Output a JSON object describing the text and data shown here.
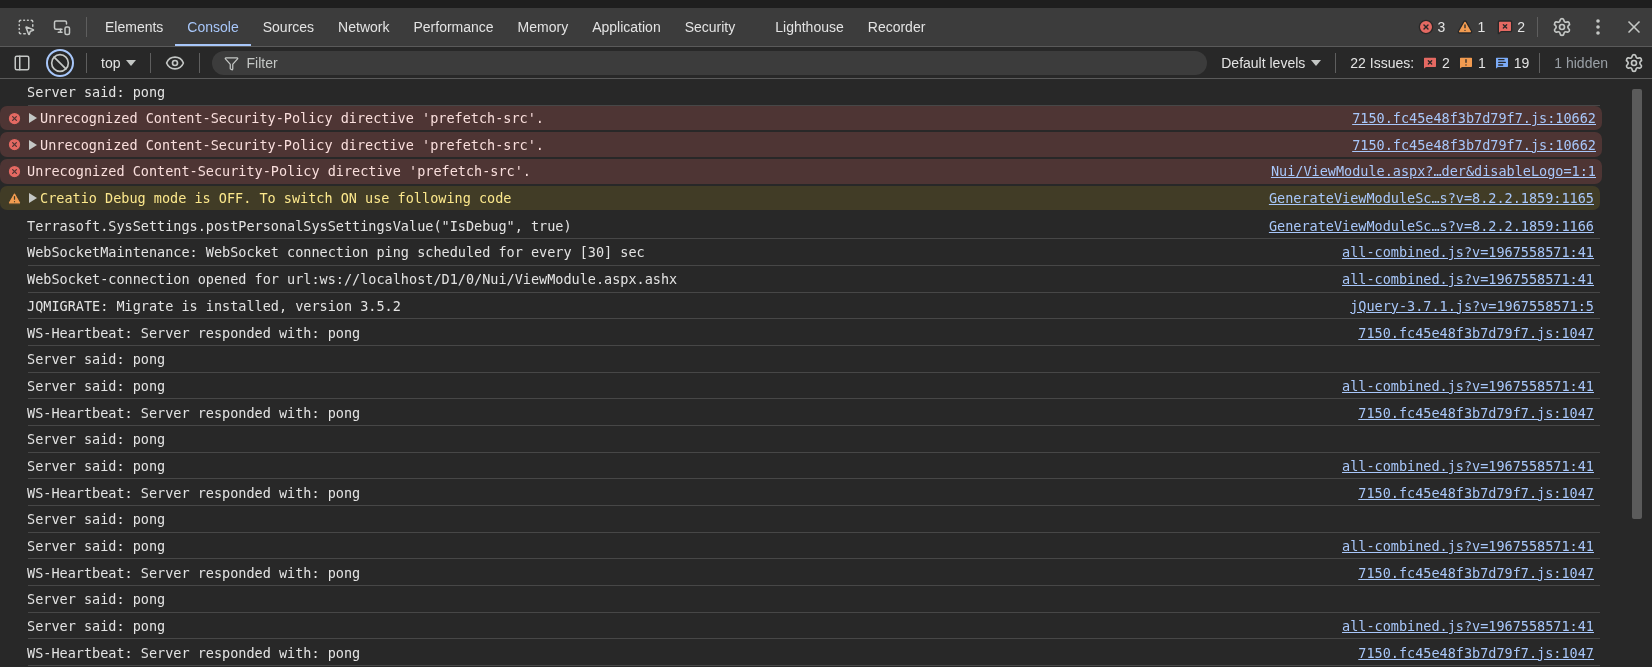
{
  "tabs": [
    {
      "label": "Elements",
      "selected": false
    },
    {
      "label": "Console",
      "selected": true
    },
    {
      "label": "Sources",
      "selected": false
    },
    {
      "label": "Network",
      "selected": false
    },
    {
      "label": "Performance",
      "selected": false
    },
    {
      "label": "Memory",
      "selected": false
    },
    {
      "label": "Application",
      "selected": false
    },
    {
      "label": "Security",
      "selected": false
    },
    {
      "label": "Lighthouse",
      "selected": false
    },
    {
      "label": "Recorder",
      "selected": false
    }
  ],
  "counters": [
    {
      "kind": "error",
      "count": "3"
    },
    {
      "kind": "warning",
      "count": "1"
    },
    {
      "kind": "issue",
      "count": "2"
    }
  ],
  "toolbar": {
    "context": "top",
    "filter": {
      "placeholder": "Filter"
    },
    "levels": "Default levels",
    "issues_label": "22 Issues:",
    "issue_badges": [
      {
        "kind": "error",
        "count": "2"
      },
      {
        "kind": "warning",
        "count": "1"
      },
      {
        "kind": "info",
        "count": "19"
      }
    ],
    "hidden": "1 hidden"
  },
  "rows": [
    {
      "kind": "log",
      "expandable": false,
      "text": "Server said: pong"
    },
    {
      "kind": "error",
      "expandable": true,
      "text": "Unrecognized Content-Security-Policy directive 'prefetch-src'.",
      "source": "7150.fc45e48f3b7d79f7.js:10662"
    },
    {
      "kind": "error",
      "expandable": true,
      "text": "Unrecognized Content-Security-Policy directive 'prefetch-src'.",
      "source": "7150.fc45e48f3b7d79f7.js:10662"
    },
    {
      "kind": "error",
      "expandable": false,
      "text": "Unrecognized Content-Security-Policy directive 'prefetch-src'.",
      "source": "Nui/ViewModule.aspx?…der&disableLogo=1:1"
    },
    {
      "kind": "warning",
      "expandable": true,
      "text": "Creatio Debug mode is OFF. To switch ON use following code",
      "source": "GenerateViewModuleSc…s?v=8.2.2.1859:1165"
    },
    {
      "kind": "log",
      "expandable": false,
      "text": "Terrasoft.SysSettings.postPersonalSysSettingsValue(\"IsDebug\", true)",
      "source": "GenerateViewModuleSc…s?v=8.2.2.1859:1166"
    },
    {
      "kind": "log",
      "expandable": false,
      "text": "WebSocketMaintenance: WebSocket connection ping scheduled for every [30] sec",
      "source": "all-combined.js?v=1967558571:41"
    },
    {
      "kind": "log",
      "expandable": false,
      "text": "WebSocket-connection opened for url:ws://localhost/D1/0/Nui/ViewModule.aspx.ashx",
      "source": "all-combined.js?v=1967558571:41"
    },
    {
      "kind": "log",
      "expandable": false,
      "text": "JQMIGRATE: Migrate is installed, version 3.5.2",
      "source": "jQuery-3.7.1.js?v=1967558571:5"
    },
    {
      "kind": "log",
      "expandable": false,
      "text": "WS-Heartbeat: Server responded with: pong",
      "source": "7150.fc45e48f3b7d79f7.js:1047"
    },
    {
      "kind": "log",
      "expandable": false,
      "text": "Server said: pong"
    },
    {
      "kind": "log",
      "expandable": false,
      "text": "Server said: pong",
      "source": "all-combined.js?v=1967558571:41"
    },
    {
      "kind": "log",
      "expandable": false,
      "text": "WS-Heartbeat: Server responded with: pong",
      "source": "7150.fc45e48f3b7d79f7.js:1047"
    },
    {
      "kind": "log",
      "expandable": false,
      "text": "Server said: pong"
    },
    {
      "kind": "log",
      "expandable": false,
      "text": "Server said: pong",
      "source": "all-combined.js?v=1967558571:41"
    },
    {
      "kind": "log",
      "expandable": false,
      "text": "WS-Heartbeat: Server responded with: pong",
      "source": "7150.fc45e48f3b7d79f7.js:1047"
    },
    {
      "kind": "log",
      "expandable": false,
      "text": "Server said: pong"
    },
    {
      "kind": "log",
      "expandable": false,
      "text": "Server said: pong",
      "source": "all-combined.js?v=1967558571:41"
    },
    {
      "kind": "log",
      "expandable": false,
      "text": "WS-Heartbeat: Server responded with: pong",
      "source": "7150.fc45e48f3b7d79f7.js:1047"
    },
    {
      "kind": "log",
      "expandable": false,
      "text": "Server said: pong"
    },
    {
      "kind": "log",
      "expandable": false,
      "text": "Server said: pong",
      "source": "all-combined.js?v=1967558571:41"
    },
    {
      "kind": "log",
      "expandable": false,
      "text": "WS-Heartbeat: Server responded with: pong",
      "source": "7150.fc45e48f3b7d79f7.js:1047"
    }
  ]
}
